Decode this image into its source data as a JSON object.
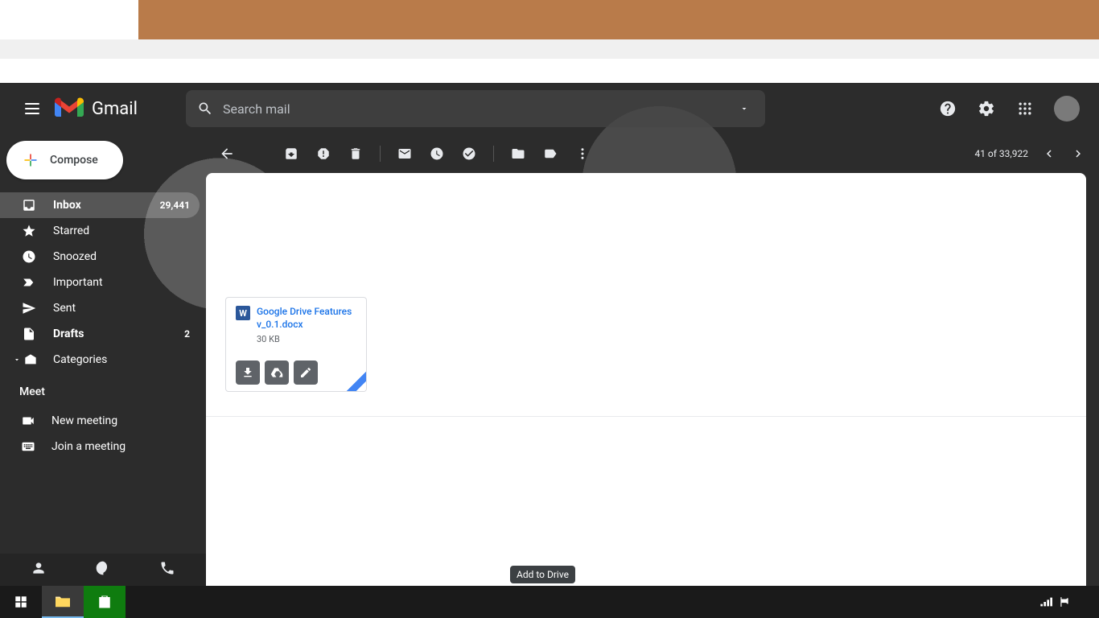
{
  "app": {
    "name": "Gmail"
  },
  "search": {
    "placeholder": "Search mail"
  },
  "compose": {
    "label": "Compose"
  },
  "sidebar": {
    "items": [
      {
        "label": "Inbox",
        "count": "29,441",
        "active": true
      },
      {
        "label": "Starred"
      },
      {
        "label": "Snoozed"
      },
      {
        "label": "Important"
      },
      {
        "label": "Sent"
      },
      {
        "label": "Drafts",
        "count": "2"
      },
      {
        "label": "Categories"
      }
    ]
  },
  "meet": {
    "title": "Meet",
    "new_meeting": "New meeting",
    "join_meeting": "Join a meeting"
  },
  "toolbar": {
    "pagination": "41 of 33,922"
  },
  "attachment": {
    "name": "Google Drive Features v_0.1.docx",
    "size": "30 KB",
    "icon_letter": "W"
  },
  "tooltip": {
    "add_to_drive": "Add to Drive"
  }
}
